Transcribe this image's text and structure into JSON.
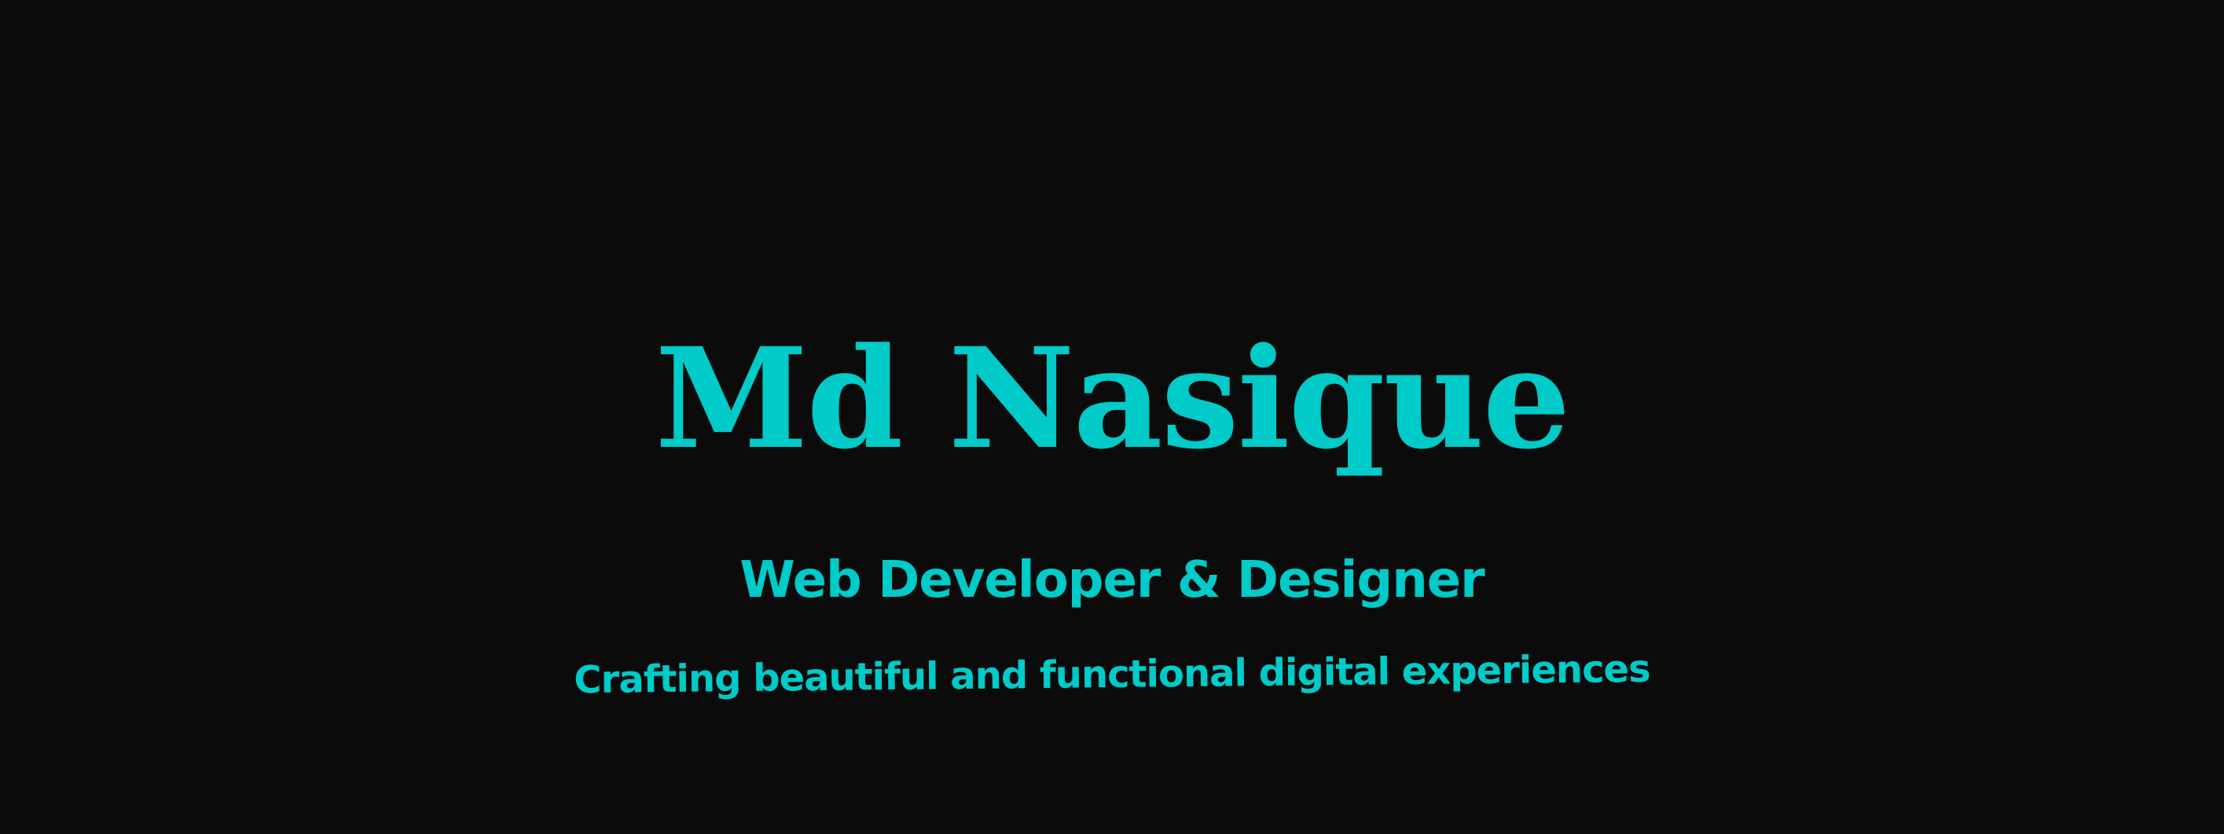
{
  "hero": {
    "name": "Md Nasique",
    "role": "Web Developer & Designer",
    "tagline": "Crafting beautiful and functional digital experiences"
  },
  "colors": {
    "background": "#0b0b0b",
    "accent": "#00cbc8"
  }
}
